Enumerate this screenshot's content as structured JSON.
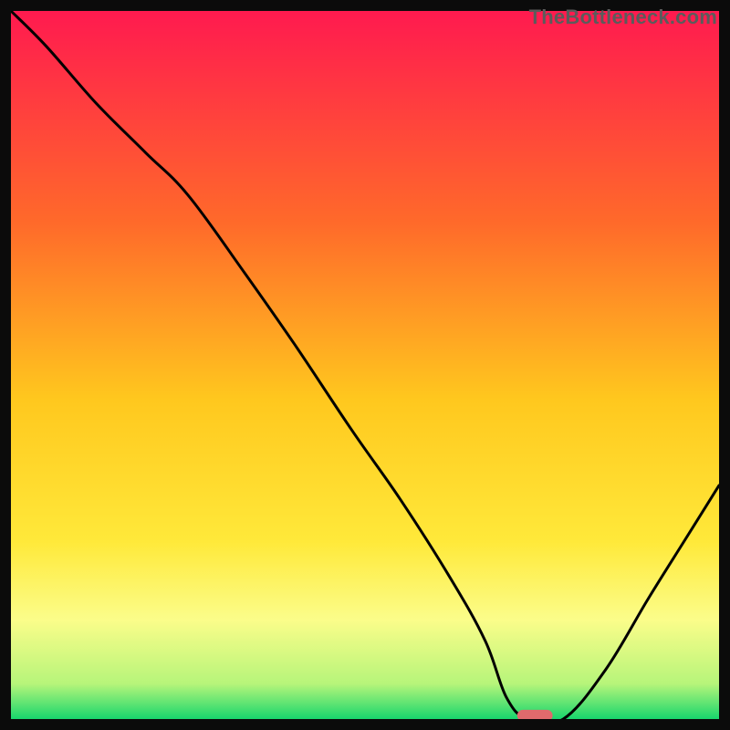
{
  "watermark": "TheBottleneck.com",
  "chart_data": {
    "type": "line",
    "title": "",
    "xlabel": "",
    "ylabel": "",
    "x_range": [
      0,
      100
    ],
    "y_range": [
      0,
      100
    ],
    "grid": false,
    "legend": false,
    "background": {
      "type": "vertical_gradient",
      "stops": [
        {
          "offset": 0.0,
          "color": "#ff1a4f"
        },
        {
          "offset": 0.3,
          "color": "#ff6a2a"
        },
        {
          "offset": 0.55,
          "color": "#ffc81e"
        },
        {
          "offset": 0.75,
          "color": "#ffe93a"
        },
        {
          "offset": 0.86,
          "color": "#fbfd8a"
        },
        {
          "offset": 0.95,
          "color": "#b7f57a"
        },
        {
          "offset": 1.0,
          "color": "#18d66d"
        }
      ]
    },
    "series": [
      {
        "name": "bottleneck-curve",
        "color": "#000000",
        "x": [
          0,
          5,
          12,
          19,
          25,
          33,
          40,
          48,
          55,
          62,
          67,
          70,
          73,
          78,
          84,
          90,
          95,
          100
        ],
        "y": [
          100,
          95,
          87,
          80,
          74,
          63,
          53,
          41,
          31,
          20,
          11,
          3,
          0,
          0,
          7,
          17,
          25,
          33
        ]
      }
    ],
    "marker": {
      "name": "optimal-point",
      "x": 74,
      "y": 0.5,
      "width": 5,
      "height": 1.6,
      "color": "#e06a6c"
    },
    "frame": {
      "color": "#0b0b0b",
      "thickness_px": 12
    }
  }
}
